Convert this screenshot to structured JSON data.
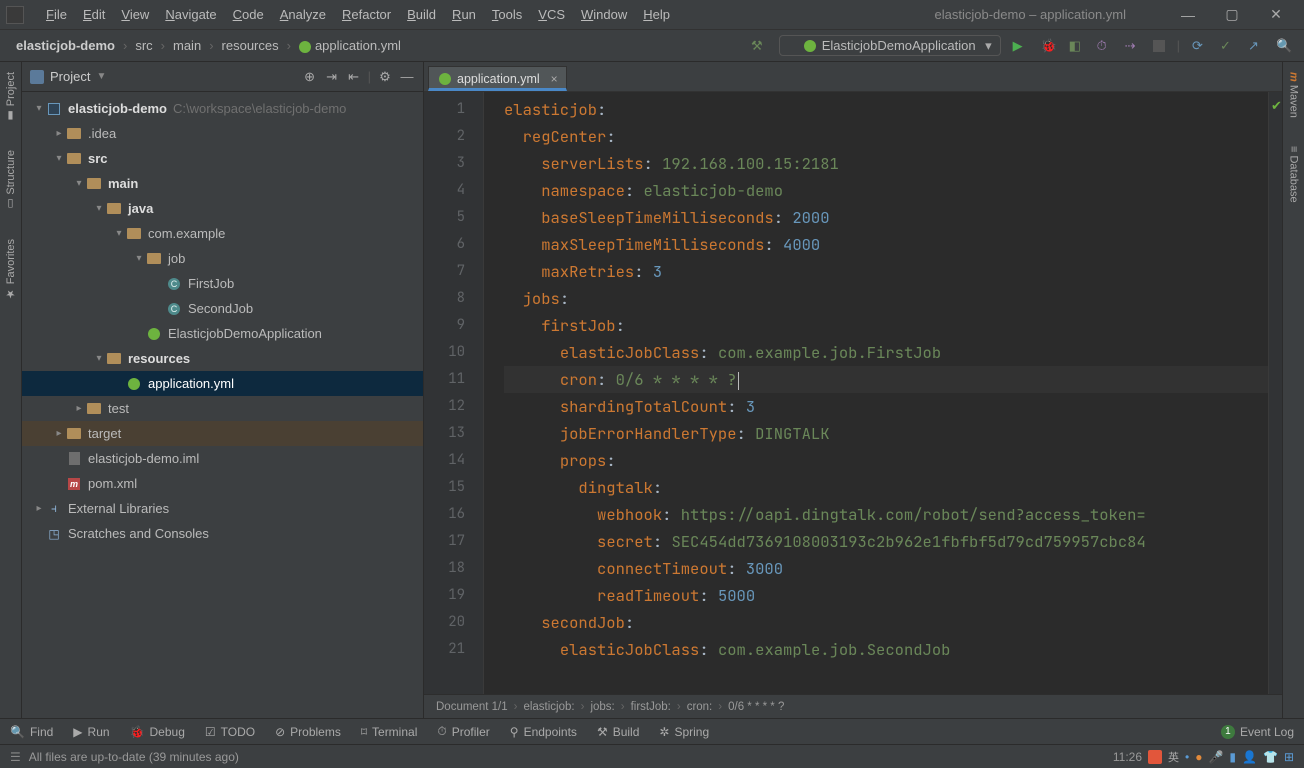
{
  "window": {
    "title": "elasticjob-demo – application.yml"
  },
  "menu": [
    "File",
    "Edit",
    "View",
    "Navigate",
    "Code",
    "Analyze",
    "Refactor",
    "Build",
    "Run",
    "Tools",
    "VCS",
    "Window",
    "Help"
  ],
  "breadcrumb": [
    "elasticjob-demo",
    "src",
    "main",
    "resources",
    "application.yml"
  ],
  "run_config": "ElasticjobDemoApplication",
  "left_tabs": [
    "Project",
    "Structure",
    "Favorites"
  ],
  "right_tabs": [
    "Maven",
    "Database"
  ],
  "project_panel": {
    "title": "Project",
    "root": {
      "name": "elasticjob-demo",
      "path": "C:\\workspace\\elasticjob-demo"
    },
    "nodes": [
      {
        "d": 1,
        "t": "folder",
        "name": ".idea",
        "exp": false
      },
      {
        "d": 1,
        "t": "folder",
        "name": "src",
        "exp": true,
        "bold": true
      },
      {
        "d": 2,
        "t": "folder",
        "name": "main",
        "exp": true,
        "bold": true
      },
      {
        "d": 3,
        "t": "folder",
        "name": "java",
        "exp": true,
        "bold": true
      },
      {
        "d": 4,
        "t": "folder",
        "name": "com.example",
        "exp": true
      },
      {
        "d": 5,
        "t": "folder",
        "name": "job",
        "exp": true
      },
      {
        "d": 6,
        "t": "class",
        "name": "FirstJob"
      },
      {
        "d": 6,
        "t": "class",
        "name": "SecondJob"
      },
      {
        "d": 5,
        "t": "spring",
        "name": "ElasticjobDemoApplication"
      },
      {
        "d": 3,
        "t": "folder",
        "name": "resources",
        "exp": true,
        "bold": true
      },
      {
        "d": 4,
        "t": "spring",
        "name": "application.yml",
        "sel": true
      },
      {
        "d": 2,
        "t": "folder",
        "name": "test",
        "exp": false
      },
      {
        "d": 1,
        "t": "folder",
        "name": "target",
        "exp": false,
        "mute": true
      },
      {
        "d": 1,
        "t": "file",
        "name": "elasticjob-demo.iml"
      },
      {
        "d": 1,
        "t": "m",
        "name": "pom.xml"
      }
    ],
    "extra": [
      {
        "name": "External Libraries"
      },
      {
        "name": "Scratches and Consoles"
      }
    ]
  },
  "editor": {
    "tab": "application.yml",
    "current_line": 11,
    "lines": [
      [
        {
          "t": "elasticjob",
          "c": "k"
        },
        {
          "t": ":",
          "c": "c"
        }
      ],
      [
        {
          "t": "  "
        },
        {
          "t": "regCenter",
          "c": "k"
        },
        {
          "t": ":",
          "c": "c"
        }
      ],
      [
        {
          "t": "    "
        },
        {
          "t": "serverLists",
          "c": "k"
        },
        {
          "t": ": ",
          "c": "c"
        },
        {
          "t": "192.168.100.15:2181",
          "c": "s"
        }
      ],
      [
        {
          "t": "    "
        },
        {
          "t": "namespace",
          "c": "k"
        },
        {
          "t": ": ",
          "c": "c"
        },
        {
          "t": "elasticjob-demo",
          "c": "s"
        }
      ],
      [
        {
          "t": "    "
        },
        {
          "t": "baseSleepTimeMilliseconds",
          "c": "k"
        },
        {
          "t": ": ",
          "c": "c"
        },
        {
          "t": "2000",
          "c": "n"
        }
      ],
      [
        {
          "t": "    "
        },
        {
          "t": "maxSleepTimeMilliseconds",
          "c": "k"
        },
        {
          "t": ": ",
          "c": "c"
        },
        {
          "t": "4000",
          "c": "n"
        }
      ],
      [
        {
          "t": "    "
        },
        {
          "t": "maxRetries",
          "c": "k"
        },
        {
          "t": ": ",
          "c": "c"
        },
        {
          "t": "3",
          "c": "n"
        }
      ],
      [
        {
          "t": "  "
        },
        {
          "t": "jobs",
          "c": "k"
        },
        {
          "t": ":",
          "c": "c"
        }
      ],
      [
        {
          "t": "    "
        },
        {
          "t": "firstJob",
          "c": "k"
        },
        {
          "t": ":",
          "c": "c"
        }
      ],
      [
        {
          "t": "      "
        },
        {
          "t": "elasticJobClass",
          "c": "k"
        },
        {
          "t": ": ",
          "c": "c"
        },
        {
          "t": "com.example.job.FirstJob",
          "c": "s"
        }
      ],
      [
        {
          "t": "      "
        },
        {
          "t": "cron",
          "c": "k"
        },
        {
          "t": ": ",
          "c": "c"
        },
        {
          "t": "0/6 * * * * ?",
          "c": "s"
        }
      ],
      [
        {
          "t": "      "
        },
        {
          "t": "shardingTotalCount",
          "c": "k"
        },
        {
          "t": ": ",
          "c": "c"
        },
        {
          "t": "3",
          "c": "n"
        }
      ],
      [
        {
          "t": "      "
        },
        {
          "t": "jobErrorHandlerType",
          "c": "k"
        },
        {
          "t": ": ",
          "c": "c"
        },
        {
          "t": "DINGTALK",
          "c": "s"
        }
      ],
      [
        {
          "t": "      "
        },
        {
          "t": "props",
          "c": "k"
        },
        {
          "t": ":",
          "c": "c"
        }
      ],
      [
        {
          "t": "        "
        },
        {
          "t": "dingtalk",
          "c": "k"
        },
        {
          "t": ":",
          "c": "c"
        }
      ],
      [
        {
          "t": "          "
        },
        {
          "t": "webhook",
          "c": "k"
        },
        {
          "t": ": ",
          "c": "c"
        },
        {
          "t": "https://oapi.dingtalk.com/robot/send?access_token=",
          "c": "s"
        }
      ],
      [
        {
          "t": "          "
        },
        {
          "t": "secret",
          "c": "k"
        },
        {
          "t": ": ",
          "c": "c"
        },
        {
          "t": "SEC454dd7369108003193c2b962e1fbfbf5d79cd759957cbc84",
          "c": "s"
        }
      ],
      [
        {
          "t": "          "
        },
        {
          "t": "connectTimeout",
          "c": "k"
        },
        {
          "t": ": ",
          "c": "c"
        },
        {
          "t": "3000",
          "c": "n"
        }
      ],
      [
        {
          "t": "          "
        },
        {
          "t": "readTimeout",
          "c": "k"
        },
        {
          "t": ": ",
          "c": "c"
        },
        {
          "t": "5000",
          "c": "n"
        }
      ],
      [
        {
          "t": "    "
        },
        {
          "t": "secondJob",
          "c": "k"
        },
        {
          "t": ":",
          "c": "c"
        }
      ],
      [
        {
          "t": "      "
        },
        {
          "t": "elasticJobClass",
          "c": "k"
        },
        {
          "t": ": ",
          "c": "c"
        },
        {
          "t": "com.example.job.SecondJob",
          "c": "s"
        }
      ]
    ],
    "doc_info": "Document 1/1",
    "bcrumb": [
      "elasticjob:",
      "jobs:",
      "firstJob:",
      "cron:",
      "0/6 * * * * ?"
    ]
  },
  "bottom": [
    "Find",
    "Run",
    "Debug",
    "TODO",
    "Problems",
    "Terminal",
    "Profiler",
    "Endpoints",
    "Build",
    "Spring"
  ],
  "bottom_right": {
    "count": "1",
    "label": "Event Log"
  },
  "status": {
    "msg": "All files are up-to-date (39 minutes ago)",
    "time": "11:26"
  }
}
